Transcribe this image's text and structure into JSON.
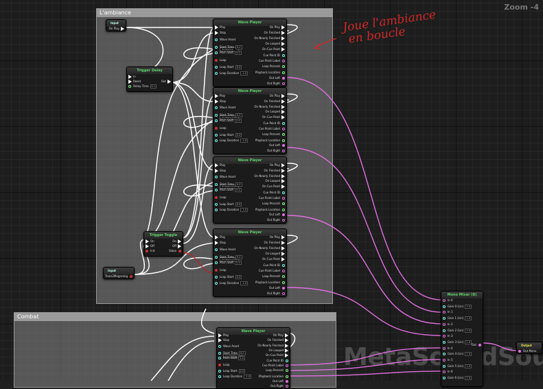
{
  "view": {
    "zoom_label": "Zoom -4"
  },
  "comments": {
    "ambiance": "L'ambiance",
    "combat": "Combat"
  },
  "annotation": {
    "line1": "Joue l'ambiance",
    "line2": "en boucle"
  },
  "watermark": "MetaSoundSource",
  "colors": {
    "audio_wire": "#e070e0",
    "exec_wire": "#ffffff",
    "bool_wire": "#c0201c"
  },
  "input_play": {
    "title": "Input",
    "pin": "On Play"
  },
  "input_bool": {
    "title": "Input",
    "pin": "Trans2Megarang"
  },
  "trigger_delay": {
    "title": "Trigger Delay",
    "pins": [
      "In",
      "Reset",
      "Delay Time"
    ],
    "delay_value": "0.1",
    "out": "Out"
  },
  "trigger_toggle": {
    "title": "Trigger Toggle",
    "pins": [
      "On",
      "Off",
      "Init"
    ],
    "outs": [
      "On",
      "Off",
      "Value"
    ]
  },
  "wave_player": {
    "title": "Wave Player",
    "inputs": [
      "Play",
      "Stop",
      "Wave Asset",
      "Start Time",
      "Pitch Shift",
      "Loop",
      "Loop Start",
      "Loop Duration"
    ],
    "outputs": [
      "On Play",
      "On Finished",
      "On Nearly Finished",
      "On Looped",
      "On Cue Point",
      "Cue Point ID",
      "Cue Point Label",
      "Loop Percent",
      "Playback Location",
      "Out Left",
      "Out Right"
    ],
    "start_time": "0.0",
    "pitch_shift": "0.0",
    "loop_start": "0.0",
    "loop_duration": "-1.0",
    "assets": [
      "Ambiance",
      "AmbianceSecret",
      "AmbianceSecret2",
      "AmbianceStorm",
      "CombatSound"
    ]
  },
  "mono_mixer": {
    "title": "Mono Mixer (8)",
    "rows": [
      "In 0",
      "Gain 0 (Lin)",
      "In 1",
      "Gain 1 (Lin)",
      "In 2",
      "Gain 2 (Lin)",
      "In 3",
      "Gain 3 (Lin)",
      "In 4",
      "Gain 4 (Lin)",
      "In 5",
      "Gain 5 (Lin)",
      "In 6",
      "Gain 6 (Lin)"
    ],
    "gain_value": "1.0",
    "out": "Out"
  },
  "output": {
    "title": "Output",
    "pin": "Out Mono"
  }
}
